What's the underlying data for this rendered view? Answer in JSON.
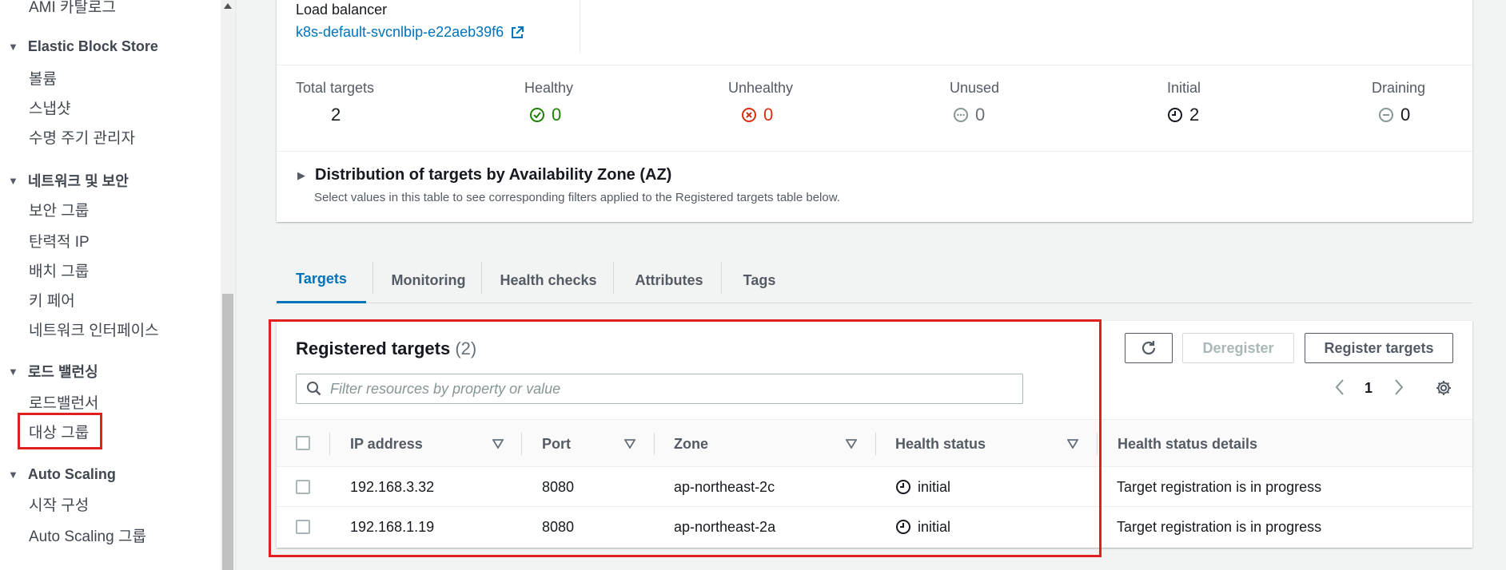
{
  "sidebar": {
    "top_item": "AMI 카탈로그",
    "sections": [
      {
        "title": "Elastic Block Store",
        "items": [
          "볼륨",
          "스냅샷",
          "수명 주기 관리자"
        ]
      },
      {
        "title": "네트워크 및 보안",
        "items": [
          "보안 그룹",
          "탄력적 IP",
          "배치 그룹",
          "키 페어",
          "네트워크 인터페이스"
        ]
      },
      {
        "title": "로드 밸런싱",
        "items": [
          "로드밸런서",
          "대상 그룹"
        ]
      },
      {
        "title": "Auto Scaling",
        "items": [
          "시작 구성",
          "Auto Scaling 그룹"
        ]
      }
    ]
  },
  "summary": {
    "lb_label": "Load balancer",
    "lb_link": "k8s-default-svcnlbip-e22aeb39f6",
    "stats": [
      {
        "label": "Total targets",
        "value": "2"
      },
      {
        "label": "Healthy",
        "value": "0"
      },
      {
        "label": "Unhealthy",
        "value": "0"
      },
      {
        "label": "Unused",
        "value": "0"
      },
      {
        "label": "Initial",
        "value": "2"
      },
      {
        "label": "Draining",
        "value": "0"
      }
    ],
    "az_title": "Distribution of targets by Availability Zone (AZ)",
    "az_subtitle": "Select values in this table to see corresponding filters applied to the Registered targets table below."
  },
  "tabs": [
    "Targets",
    "Monitoring",
    "Health checks",
    "Attributes",
    "Tags"
  ],
  "registered": {
    "title": "Registered targets",
    "count": "(2)",
    "deregister_label": "Deregister",
    "register_label": "Register targets",
    "search_placeholder": "Filter resources by property or value",
    "page": "1",
    "columns": [
      "IP address",
      "Port",
      "Zone",
      "Health status",
      "Health status details"
    ],
    "rows": [
      {
        "ip": "192.168.3.32",
        "port": "8080",
        "zone": "ap-northeast-2c",
        "status": "initial",
        "details": "Target registration is in progress"
      },
      {
        "ip": "192.168.1.19",
        "port": "8080",
        "zone": "ap-northeast-2a",
        "status": "initial",
        "details": "Target registration is in progress"
      }
    ]
  },
  "colors": {
    "accent": "#0073bb",
    "healthy": "#1d8102",
    "unhealthy": "#d13212",
    "highlight": "#e02020"
  }
}
